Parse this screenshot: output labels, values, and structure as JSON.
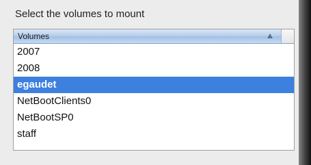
{
  "dialog": {
    "title": "Select the volumes to mount"
  },
  "volumes_table": {
    "column_header": "Volumes",
    "sort_icon": "sort-ascending-icon",
    "selected_color": "#3d80df",
    "rows": [
      {
        "label": "2007",
        "selected": false
      },
      {
        "label": "2008",
        "selected": false
      },
      {
        "label": "egaudet",
        "selected": true
      },
      {
        "label": "NetBootClients0",
        "selected": false
      },
      {
        "label": "NetBootSP0",
        "selected": false
      },
      {
        "label": "staff",
        "selected": false
      }
    ]
  }
}
